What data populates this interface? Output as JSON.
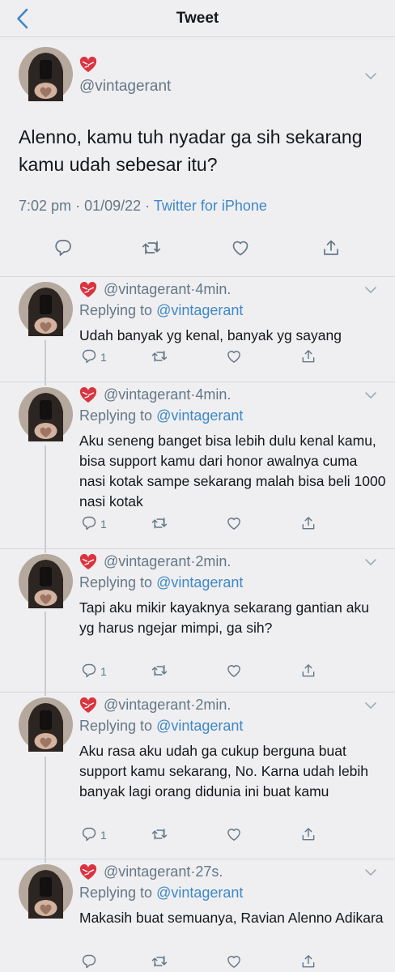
{
  "header": {
    "title": "Tweet"
  },
  "tweet": {
    "handle": "@vintagerant",
    "text": "Alenno, kamu tuh nyadar ga sih sekarang kamu udah sebesar itu?",
    "time": "7:02 pm",
    "date": "01/09/22",
    "source": "Twitter for iPhone"
  },
  "replies": [
    {
      "handle": "@vintagerant",
      "time": "4min.",
      "replying_label": "Replying to",
      "replying_to": "@vintagerant",
      "text": "Udah banyak yg kenal, banyak yg sayang",
      "reply_count": "1"
    },
    {
      "handle": "@vintagerant",
      "time": "4min.",
      "replying_label": "Replying to",
      "replying_to": "@vintagerant",
      "text": "Aku seneng banget bisa lebih dulu kenal kamu, bisa support kamu dari honor awalnya cuma nasi kotak sampe sekarang malah bisa beli 1000 nasi kotak",
      "reply_count": "1"
    },
    {
      "handle": "@vintagerant",
      "time": "2min.",
      "replying_label": "Replying to",
      "replying_to": "@vintagerant",
      "text": "Tapi aku mikir kayaknya sekarang gantian aku yg harus ngejar mimpi, ga sih?",
      "reply_count": "1"
    },
    {
      "handle": "@vintagerant",
      "time": "2min.",
      "replying_label": "Replying to",
      "replying_to": "@vintagerant",
      "text": "Aku rasa aku udah ga cukup berguna buat support kamu sekarang, No. Karna udah lebih banyak lagi orang didunia ini buat kamu",
      "reply_count": "1"
    },
    {
      "handle": "@vintagerant",
      "time": "27s.",
      "replying_label": "Replying to",
      "replying_to": "@vintagerant",
      "text": "Makasih buat semuanya, Ravian Alenno Adikara",
      "reply_count": ""
    }
  ],
  "icons": {
    "back": "chevron-left-icon",
    "reply": "reply-icon",
    "retweet": "retweet-icon",
    "like": "heart-outline-icon",
    "share": "share-icon",
    "more": "chevron-down-icon",
    "emoji": "mending-heart-emoji"
  },
  "colors": {
    "background": "#efeff2",
    "link": "#3f88c5",
    "secondary": "#657786",
    "text": "#14171a",
    "heart": "#d9343f"
  }
}
